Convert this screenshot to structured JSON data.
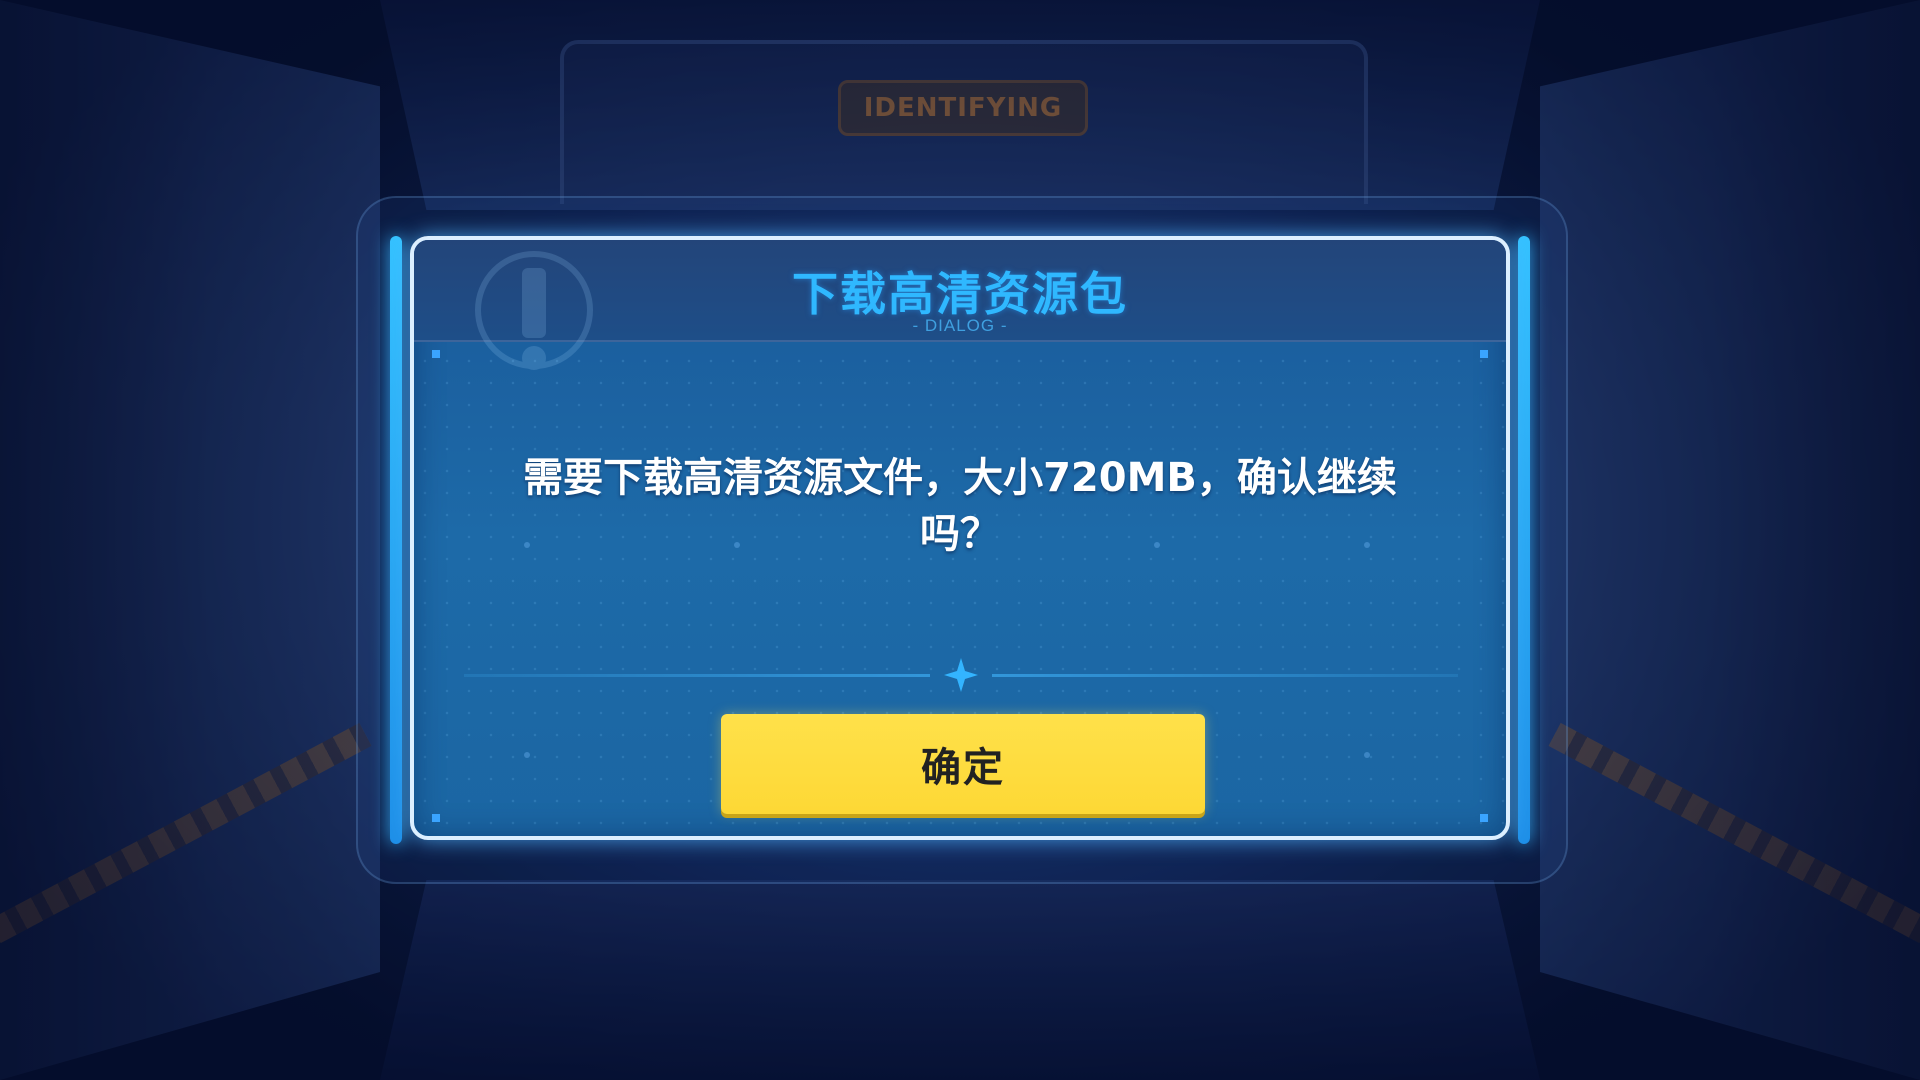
{
  "background": {
    "sign_text": "IDENTIFYING"
  },
  "dialog": {
    "title": "下载高清资源包",
    "subtitle": "- DIALOG -",
    "message": "需要下载高清资源文件，大小720MB，确认继续吗？",
    "confirm_label": "确定"
  },
  "colors": {
    "title": "#2fb8ff",
    "button": "#fdd835",
    "frame": "#dcefff",
    "panel": "#1d6aa8"
  },
  "icons": {
    "header_watermark": "exclamation-icon",
    "divider": "four-point-star-icon"
  }
}
